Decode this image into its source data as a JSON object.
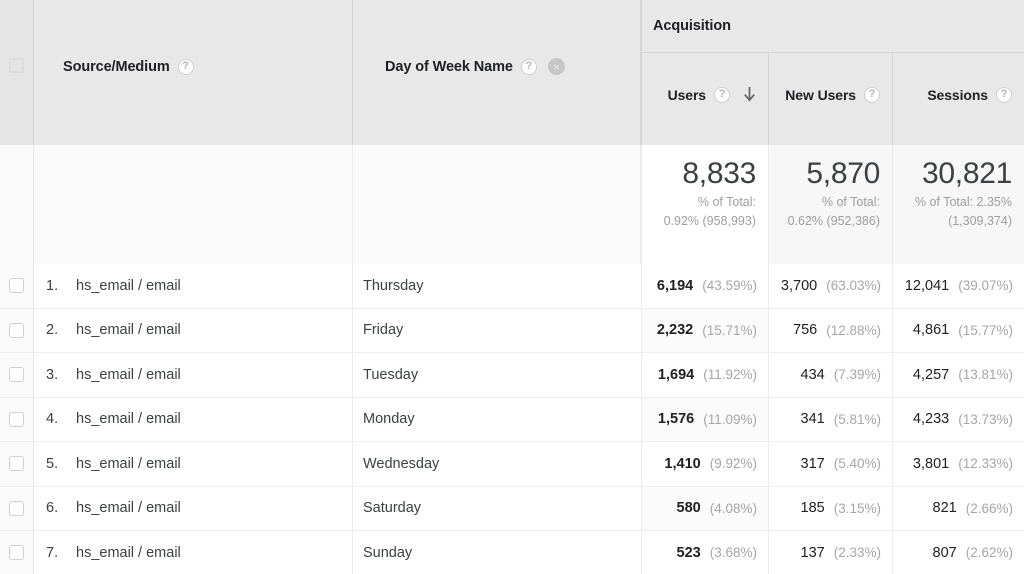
{
  "table": {
    "dimension_columns": [
      {
        "label": "Source/Medium",
        "help_icon": "help-icon",
        "help_glyph": "?",
        "removable": false
      },
      {
        "label": "Day of Week Name",
        "help_icon": "help-icon",
        "help_glyph": "?",
        "removable": true,
        "remove_icon": "remove-icon",
        "remove_glyph": "×"
      }
    ],
    "metric_group": {
      "label": "Acquisition"
    },
    "metric_columns": [
      {
        "label": "Users",
        "help_glyph": "?",
        "sorted": true,
        "sort_direction": "descending",
        "sort_icon": "sort-down-arrow-icon"
      },
      {
        "label": "New Users",
        "help_glyph": "?",
        "sorted": false
      },
      {
        "label": "Sessions",
        "help_glyph": "?",
        "sorted": false
      }
    ],
    "select_all_checkbox": "select-all-checkbox",
    "totals": [
      {
        "value": "8,833",
        "pct_line1": "% of Total:",
        "pct_line2": "0.92% (958,993)"
      },
      {
        "value": "5,870",
        "pct_line1": "% of Total:",
        "pct_line2": "0.62% (952,386)"
      },
      {
        "value": "30,821",
        "pct_line1": "% of Total: 2.35%",
        "pct_line2": "(1,309,374)"
      }
    ],
    "rows": [
      {
        "index": "1.",
        "source": "hs_email / email",
        "day": "Thursday",
        "users": "6,194",
        "users_pct": "(43.59%)",
        "new_users": "3,700",
        "new_users_pct": "(63.03%)",
        "sessions": "12,041",
        "sessions_pct": "(39.07%)"
      },
      {
        "index": "2.",
        "source": "hs_email / email",
        "day": "Friday",
        "users": "2,232",
        "users_pct": "(15.71%)",
        "new_users": "756",
        "new_users_pct": "(12.88%)",
        "sessions": "4,861",
        "sessions_pct": "(15.77%)"
      },
      {
        "index": "3.",
        "source": "hs_email / email",
        "day": "Tuesday",
        "users": "1,694",
        "users_pct": "(11.92%)",
        "new_users": "434",
        "new_users_pct": "(7.39%)",
        "sessions": "4,257",
        "sessions_pct": "(13.81%)"
      },
      {
        "index": "4.",
        "source": "hs_email / email",
        "day": "Monday",
        "users": "1,576",
        "users_pct": "(11.09%)",
        "new_users": "341",
        "new_users_pct": "(5.81%)",
        "sessions": "4,233",
        "sessions_pct": "(13.73%)"
      },
      {
        "index": "5.",
        "source": "hs_email / email",
        "day": "Wednesday",
        "users": "1,410",
        "users_pct": "(9.92%)",
        "new_users": "317",
        "new_users_pct": "(5.40%)",
        "sessions": "3,801",
        "sessions_pct": "(12.33%)"
      },
      {
        "index": "6.",
        "source": "hs_email / email",
        "day": "Saturday",
        "users": "580",
        "users_pct": "(4.08%)",
        "new_users": "185",
        "new_users_pct": "(3.15%)",
        "sessions": "821",
        "sessions_pct": "(2.66%)"
      },
      {
        "index": "7.",
        "source": "hs_email / email",
        "day": "Sunday",
        "users": "523",
        "users_pct": "(3.68%)",
        "new_users": "137",
        "new_users_pct": "(2.33%)",
        "sessions": "807",
        "sessions_pct": "(2.62%)"
      }
    ]
  },
  "colors": {
    "header_bg": "#e8e8e8",
    "text_primary": "#202124",
    "text_secondary": "#a6a6a6",
    "row_border": "#eeeeee"
  }
}
